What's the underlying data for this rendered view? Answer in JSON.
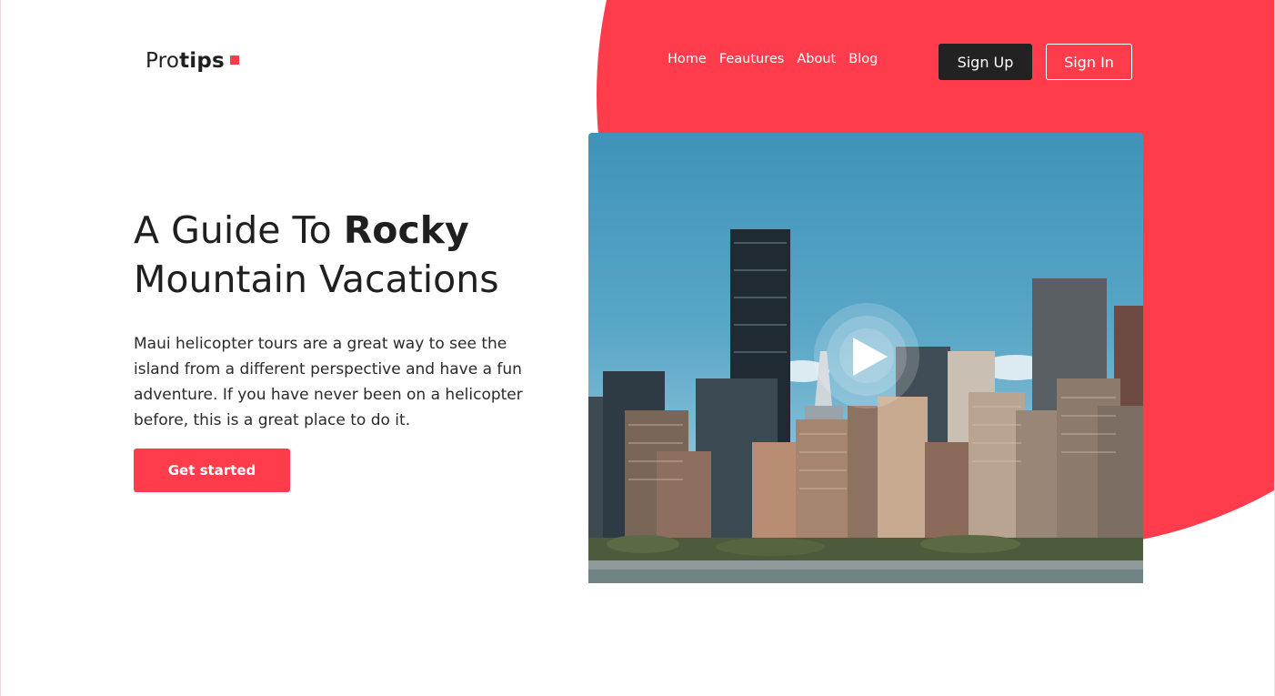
{
  "brand": {
    "logo_light": "Pro",
    "logo_bold": "tips",
    "accent_color": "#ff3c4b"
  },
  "nav": {
    "items": [
      "Home",
      "Feautures",
      "About",
      "Blog"
    ]
  },
  "auth": {
    "signup_label": "Sign Up",
    "signin_label": "Sign In"
  },
  "hero": {
    "headline_pre": "A Guide To ",
    "headline_bold": "Rocky",
    "headline_post": "Mountain Vacations",
    "description": "Maui helicopter tours are a great way to see the island from a different perspective and have a fun adventure. If you have never been on a helicopter before, this is a great place to do it.",
    "cta_label": "Get started"
  },
  "video": {
    "icon": "play-icon"
  }
}
